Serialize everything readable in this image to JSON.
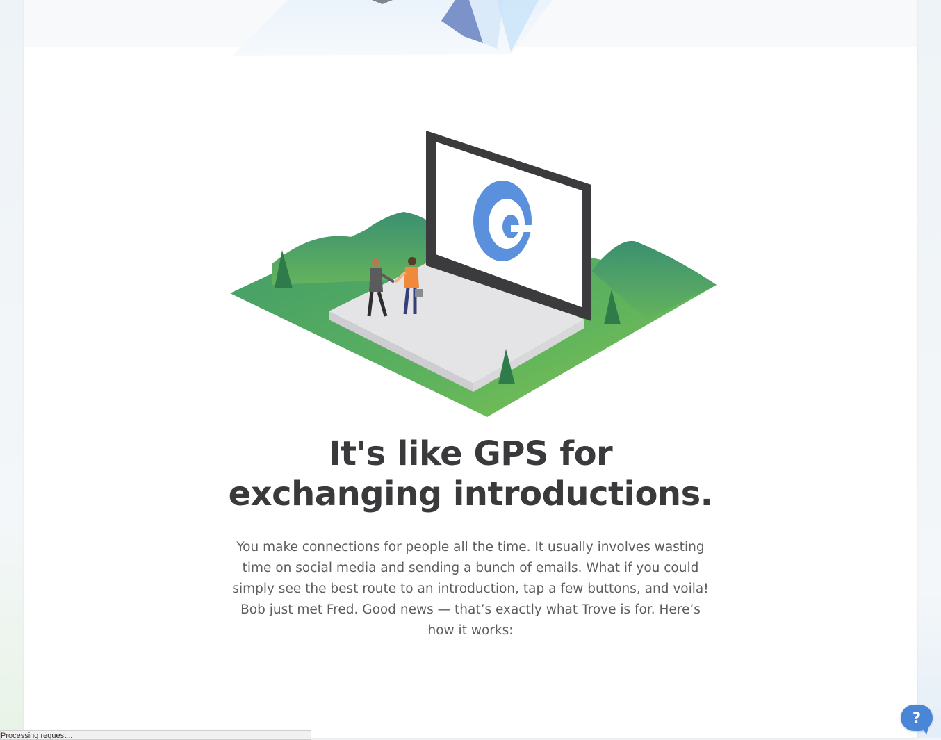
{
  "main": {
    "headline_line1": "It's like GPS for",
    "headline_line2": "exchanging introductions.",
    "intro_text": "You make connections for people all the time. It usually involves wasting time on social media and sending a bunch of emails. What if you could simply see the best route to an introduction, tap a few buttons, and voila! Bob just met Fred. Good news — that’s exactly what Trove is for. Here’s how it works:"
  },
  "hero": {
    "illustration": "laptop-with-handshake-illustration",
    "logo_icon": "trove-logo-icon"
  },
  "status_bar": {
    "text": "Processing request..."
  },
  "help": {
    "label": "?",
    "icon": "help-chat-icon"
  },
  "colors": {
    "headline": "#3a3a3c",
    "body_text": "#5c5d60",
    "accent_blue": "#4a86d8",
    "grass_green": "#5fae5c",
    "laptop_dark": "#3b3b3d"
  }
}
